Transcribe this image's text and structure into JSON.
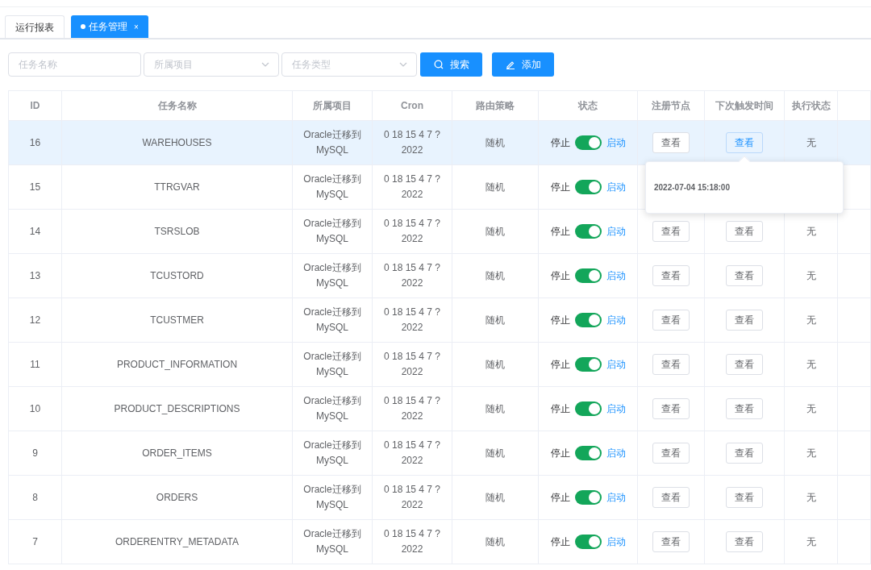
{
  "tabs": [
    {
      "label": "运行报表",
      "selected": false
    },
    {
      "label": "任务管理",
      "selected": true,
      "close": "×"
    }
  ],
  "filters": [
    {
      "kind": "input",
      "placeholder": "任务名称"
    },
    {
      "kind": "select",
      "placeholder": "所属项目"
    },
    {
      "kind": "select",
      "placeholder": "任务类型"
    }
  ],
  "buttons": [
    {
      "kind": "search",
      "label": "搜索"
    },
    {
      "kind": "add",
      "label": "添加"
    }
  ],
  "table": {
    "columns": [
      "ID",
      "任务名称",
      "所属项目",
      "Cron",
      "路由策略",
      "状态",
      "注册节点",
      "下次触发时间",
      "执行状态"
    ],
    "rows": [
      {
        "id": "16",
        "name": "WAREHOUSES",
        "project": "Oracle迁移到MySQL",
        "cron": "0 18 15 4 7 ? 2022",
        "route": "随机",
        "status": {
          "off_label": "停止",
          "on": true,
          "on_label": "启动"
        },
        "node": "查看",
        "next": {
          "label": "查看",
          "active": true,
          "popover": "2022-07-04 15:18:00"
        },
        "exec": "无",
        "selected": true
      },
      {
        "id": "15",
        "name": "TTRGVAR",
        "project": "Oracle迁移到MySQL",
        "cron": "0 18 15 4 7 ? 2022",
        "route": "随机",
        "status": {
          "off_label": "停止",
          "on": true,
          "on_label": "启动"
        },
        "selected": false
      },
      {
        "id": "14",
        "name": "TSRSLOB",
        "project": "Oracle迁移到MySQL",
        "cron": "0 18 15 4 7 ? 2022",
        "route": "随机",
        "status": {
          "off_label": "停止",
          "on": true,
          "on_label": "启动"
        },
        "node": "查看",
        "next": {
          "label": "查看",
          "active": false
        },
        "exec": "无",
        "selected": false
      },
      {
        "id": "13",
        "name": "TCUSTORD",
        "project": "Oracle迁移到MySQL",
        "cron": "0 18 15 4 7 ? 2022",
        "route": "随机",
        "status": {
          "off_label": "停止",
          "on": true,
          "on_label": "启动"
        },
        "node": "查看",
        "next": {
          "label": "查看",
          "active": false
        },
        "exec": "无",
        "selected": false
      },
      {
        "id": "12",
        "name": "TCUSTMER",
        "project": "Oracle迁移到MySQL",
        "cron": "0 18 15 4 7 ? 2022",
        "route": "随机",
        "status": {
          "off_label": "停止",
          "on": true,
          "on_label": "启动"
        },
        "node": "查看",
        "next": {
          "label": "查看",
          "active": false
        },
        "exec": "无",
        "selected": false
      },
      {
        "id": "11",
        "name": "PRODUCT_INFORMATION",
        "project": "Oracle迁移到MySQL",
        "cron": "0 18 15 4 7 ? 2022",
        "route": "随机",
        "status": {
          "off_label": "停止",
          "on": true,
          "on_label": "启动"
        },
        "node": "查看",
        "next": {
          "label": "查看",
          "active": false
        },
        "exec": "无",
        "selected": false
      },
      {
        "id": "10",
        "name": "PRODUCT_DESCRIPTIONS",
        "project": "Oracle迁移到MySQL",
        "cron": "0 18 15 4 7 ? 2022",
        "route": "随机",
        "status": {
          "off_label": "停止",
          "on": true,
          "on_label": "启动"
        },
        "node": "查看",
        "next": {
          "label": "查看",
          "active": false
        },
        "exec": "无",
        "selected": false
      },
      {
        "id": "9",
        "name": "ORDER_ITEMS",
        "project": "Oracle迁移到MySQL",
        "cron": "0 18 15 4 7 ? 2022",
        "route": "随机",
        "status": {
          "off_label": "停止",
          "on": true,
          "on_label": "启动"
        },
        "node": "查看",
        "next": {
          "label": "查看",
          "active": false
        },
        "exec": "无",
        "selected": false
      },
      {
        "id": "8",
        "name": "ORDERS",
        "project": "Oracle迁移到MySQL",
        "cron": "0 18 15 4 7 ? 2022",
        "route": "随机",
        "status": {
          "off_label": "停止",
          "on": true,
          "on_label": "启动"
        },
        "node": "查看",
        "next": {
          "label": "查看",
          "active": false
        },
        "exec": "无",
        "selected": false
      },
      {
        "id": "7",
        "name": "ORDERENTRY_METADATA",
        "project": "Oracle迁移到MySQL",
        "cron": "0 18 15 4 7 ? 2022",
        "route": "随机",
        "status": {
          "off_label": "停止",
          "on": true,
          "on_label": "启动"
        },
        "node": "查看",
        "next": {
          "label": "查看",
          "active": false
        },
        "exec": "无",
        "selected": false
      }
    ]
  }
}
